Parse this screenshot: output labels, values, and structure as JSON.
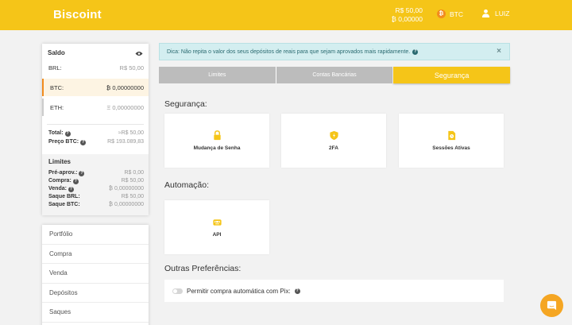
{
  "header": {
    "logo": "Biscoint",
    "balance_brl": "R$ 50,00",
    "balance_btc": "₿ 0,00000",
    "coin_label": "BTC",
    "coin_symbol": "₿",
    "user_name": "LUIZ",
    "bg_color": "#f5c518"
  },
  "saldo": {
    "title": "Saldo",
    "rows": [
      {
        "label": "BRL:",
        "value": "R$ 50,00"
      },
      {
        "label": "BTC:",
        "value": "₿ 0,00000000"
      },
      {
        "label": "ETH:",
        "value": "Ξ 0,00000000"
      }
    ],
    "total_label": "Total:",
    "total_value": "≈R$ 50,00",
    "price_label": "Preço BTC:",
    "price_value": "R$ 193.089,83"
  },
  "limits": {
    "title": "Limites",
    "rows": [
      {
        "label": "Pré-aprov.:",
        "value": "R$ 0,00",
        "help": true
      },
      {
        "label": "Compra:",
        "value": "R$ 50,00",
        "help": true
      },
      {
        "label": "Venda:",
        "value": "₿ 0,00000000",
        "help": true
      },
      {
        "label": "Saque BRL:",
        "value": "R$ 50,00",
        "help": false
      },
      {
        "label": "Saque BTC:",
        "value": "₿ 0,00000000",
        "help": false
      }
    ]
  },
  "nav": {
    "items": [
      "Portfólio",
      "Compra",
      "Venda",
      "Depósitos",
      "Saques"
    ]
  },
  "alert": {
    "text": "Dica: Não repita o valor dos seus depósitos de reais para que sejam aprovados mais rapidamente.",
    "close": "×"
  },
  "tabs": {
    "items": [
      "Limites",
      "Contas Bancárias",
      "Segurança"
    ],
    "active": "Segurança"
  },
  "security": {
    "title": "Segurança:",
    "cards": [
      "Mudança de Senha",
      "2FA",
      "Sessões Ativas"
    ]
  },
  "automation": {
    "title": "Automação:",
    "cards": [
      "API"
    ]
  },
  "preferences": {
    "title": "Outras Preferências:",
    "pix_label": "Permitir compra automática com Pix:",
    "pix_enabled": false
  },
  "icons": {
    "accent": "#f5c518",
    "orange": "#f28c1e"
  }
}
